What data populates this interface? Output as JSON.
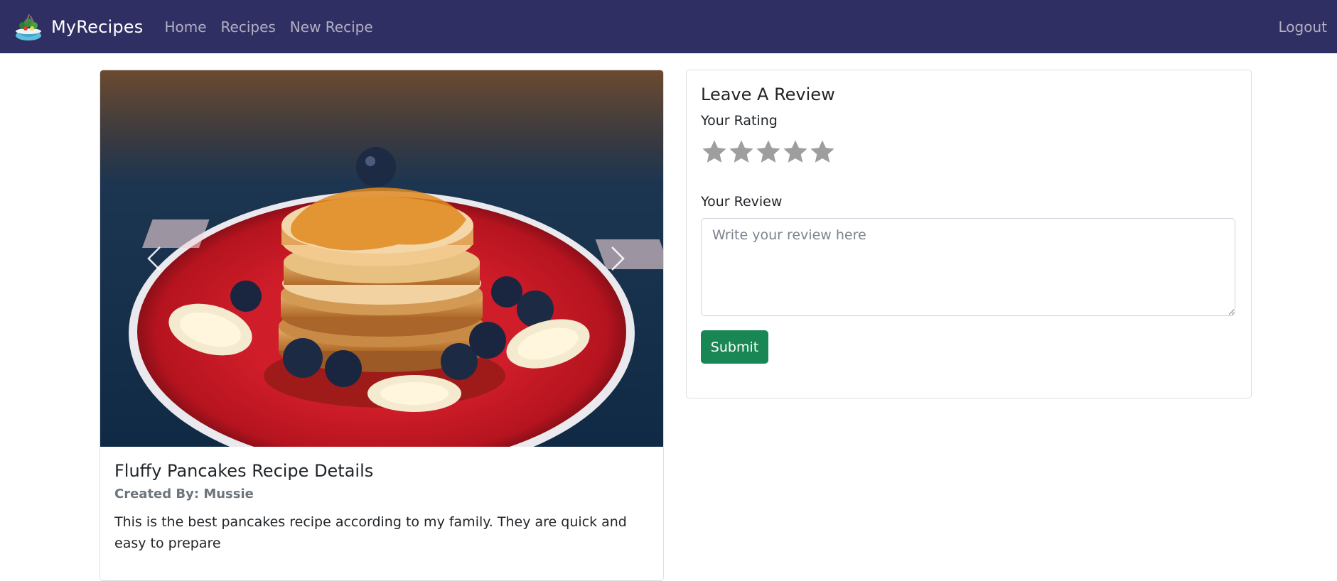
{
  "navbar": {
    "brand": "MyRecipes",
    "links": [
      {
        "label": "Home"
      },
      {
        "label": "Recipes"
      },
      {
        "label": "New Recipe"
      }
    ],
    "logout": "Logout",
    "bg_color": "#302f63"
  },
  "recipe": {
    "title": "Fluffy Pancakes Recipe Details",
    "author": "Created By: Mussie",
    "description": "This is the best pancakes recipe according to my family. They are quick and easy to prepare"
  },
  "review": {
    "heading": "Leave A Review",
    "rating_label": "Your Rating",
    "rating": 0,
    "max_rating": 5,
    "star_color": "#9e9e9e",
    "review_label": "Your Review",
    "placeholder": "Write your review here",
    "value": "",
    "submit_label": "Submit",
    "submit_color": "#198754"
  }
}
